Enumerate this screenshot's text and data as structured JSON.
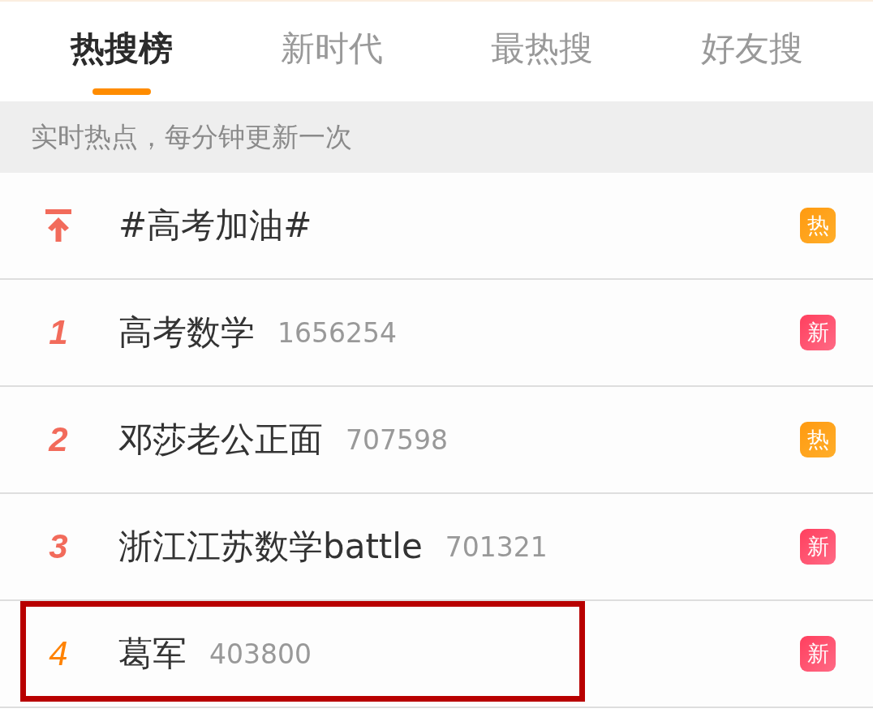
{
  "tabs": [
    {
      "label": "热搜榜",
      "selected": true
    },
    {
      "label": "新时代",
      "selected": false
    },
    {
      "label": "最热搜",
      "selected": false
    },
    {
      "label": "好友搜",
      "selected": false
    }
  ],
  "notice": "实时热点，每分钟更新一次",
  "rows": [
    {
      "kind": "pinned",
      "title": "#高考加油#",
      "badge": {
        "kind": "hot",
        "text": "热"
      },
      "highlighted": false
    },
    {
      "kind": "top",
      "rank": {
        "text": "1",
        "color": "#f26b5b"
      },
      "title": "高考数学",
      "count": "1656254",
      "badge": {
        "kind": "new",
        "text": "新"
      },
      "highlighted": false
    },
    {
      "kind": "top",
      "rank": {
        "text": "2",
        "color": "#f26b5b"
      },
      "title": "邓莎老公正面",
      "count": "707598",
      "badge": {
        "kind": "hot",
        "text": "热"
      },
      "highlighted": false
    },
    {
      "kind": "top",
      "rank": {
        "text": "3",
        "color": "#f26b5b"
      },
      "title": "浙江江苏数学battle",
      "count": "701321",
      "badge": {
        "kind": "new",
        "text": "新"
      },
      "highlighted": false
    },
    {
      "kind": "regular",
      "rank": {
        "text": "4",
        "color": "#ff8200"
      },
      "title": "葛军",
      "count": "403800",
      "badge": {
        "kind": "new",
        "text": "新"
      },
      "highlighted": true
    }
  ]
}
